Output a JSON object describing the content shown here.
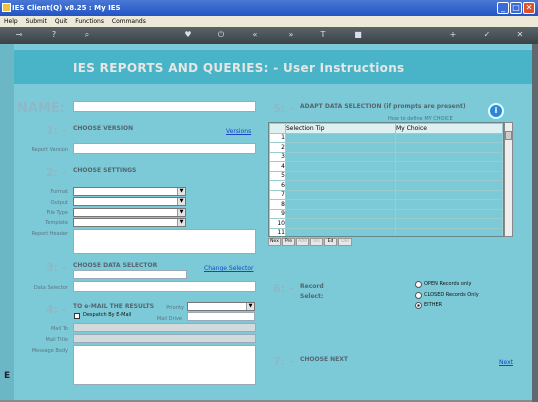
{
  "window": {
    "title": "IES Client(Q) v8.25 : My IES",
    "min": "_",
    "max": "□",
    "close": "✕"
  },
  "menu": [
    "Help",
    "Submit",
    "Quit",
    "Functions",
    "Commands"
  ],
  "toolbar": {
    "icons": [
      "key-icon",
      "help-icon",
      "search-icon",
      "heart-icon",
      "power-icon",
      "rewind-icon",
      "forward-icon",
      "text-icon",
      "stop-icon",
      "add-icon",
      "check-icon",
      "close-icon"
    ],
    "glyphs": [
      "⊸",
      "?",
      "⌕",
      "♥",
      "⏻",
      "«",
      "»",
      "T",
      "■",
      "+",
      "✓",
      "✕"
    ]
  },
  "page": {
    "title": "IES REPORTS AND QUERIES: -   User Instructions"
  },
  "name": {
    "label": "NAME:"
  },
  "s1": {
    "num": "1: -",
    "title": "CHOOSE VERSION",
    "link": "Versions",
    "field_label": "Report Version"
  },
  "s2": {
    "num": "2: -",
    "title": "CHOOSE SETTINGS",
    "labels": [
      "Format",
      "Output",
      "File Type",
      "Template",
      "Report Header"
    ]
  },
  "s3": {
    "num": "3: -",
    "title": "CHOOSE DATA SELECTOR",
    "link": "Change Selector",
    "field_label": "Data Selector"
  },
  "s4": {
    "num": "4: -",
    "title": "TO e-MAIL THE RESULTS",
    "priority_label": "Priority",
    "mail_drive_label": "Mail Drive",
    "checkbox_label": "Despatch By E-Mail",
    "mail_to": "Mail To",
    "mail_title": "Mail Title",
    "message_body": "Message Body"
  },
  "s5": {
    "num": "5: -",
    "title": "ADAPT DATA SELECTION (if prompts are present)",
    "hint": "How to define MY CHOICE",
    "info": "i",
    "col1": "Selection Tip",
    "col2": "My Choice",
    "rows": [
      "1",
      "2",
      "3",
      "4",
      "5",
      "6",
      "7",
      "8",
      "9",
      "10",
      "11"
    ],
    "buttons": [
      "Nex",
      "Pre",
      "Add",
      "Ins",
      "Ed",
      "Del"
    ]
  },
  "s6": {
    "num": "6: -",
    "label1": "Record",
    "label2": "Select:",
    "options": [
      "OPEN Records only",
      "CLOSED Records Only",
      "EITHER"
    ],
    "selected": 2
  },
  "s7": {
    "num": "7: -",
    "title": "CHOOSE NEXT",
    "link": "Next"
  },
  "side": {
    "glyph": "E"
  }
}
